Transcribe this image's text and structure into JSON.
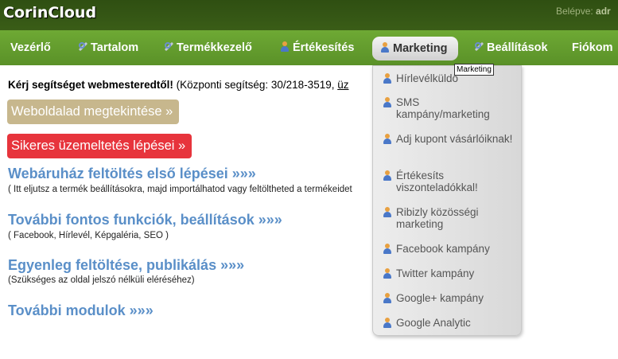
{
  "header": {
    "brand": "CorinCloud",
    "login_label": "Belépve:",
    "login_user": "adr"
  },
  "nav": {
    "items": [
      {
        "label": "Vezérlő"
      },
      {
        "label": "Tartalom",
        "icon": "wrench-icon"
      },
      {
        "label": "Termékkezelő",
        "icon": "wrench-icon"
      },
      {
        "label": "Értékesítés",
        "icon": "user-icon"
      },
      {
        "label": "Marketing",
        "icon": "user-icon",
        "active": true
      },
      {
        "label": "Beállítások",
        "icon": "wrench-icon"
      },
      {
        "label": "Fiókom"
      }
    ],
    "tooltip": "Marketing"
  },
  "dropdown": {
    "items": [
      {
        "label": "Hírlevélküldő"
      },
      {
        "label": "SMS kampány/marketing"
      },
      {
        "label": "Adj kupont vásárlóiknak!"
      },
      {
        "label": "Értékesíts viszonteladókkal!"
      },
      {
        "label": "Ribizly közösségi marketing"
      },
      {
        "label": "Facebook kampány"
      },
      {
        "label": "Twitter kampány"
      },
      {
        "label": "Google+ kampány"
      },
      {
        "label": "Google Analytic"
      }
    ]
  },
  "main": {
    "help_bold": "Kérj segítséget webmesteredtől!",
    "help_text": " (Központi segítség: 30/218-3519, ",
    "help_link": "üz",
    "buttons": {
      "view_site": "Weboldalad megtekintése »",
      "success_steps": "Sikeres üzemeltetés lépései »"
    },
    "sections": [
      {
        "title": "Webáruház feltöltés első lépései »»»",
        "subtitle": "( Itt eljutsz a termék beállításokra, majd importálhatod vagy feltöltheted a termékeidet"
      },
      {
        "title": "További fontos funkciók, beállítások »»»",
        "subtitle": "( Facebook, Hírlevél, Képgaléria, SEO )"
      },
      {
        "title": "Egyenleg feltöltése, publikálás »»»",
        "subtitle": "(Szükséges az oldal jelszó nélküli eléréséhez)"
      },
      {
        "title": "További modulok »»»",
        "subtitle": ""
      }
    ]
  },
  "colors": {
    "top_bar": "#2f4f12",
    "nav_bar": "#6ea934",
    "link_blue": "#5a8fc8",
    "button_tan": "#c7b78d",
    "button_red": "#e7343c"
  }
}
